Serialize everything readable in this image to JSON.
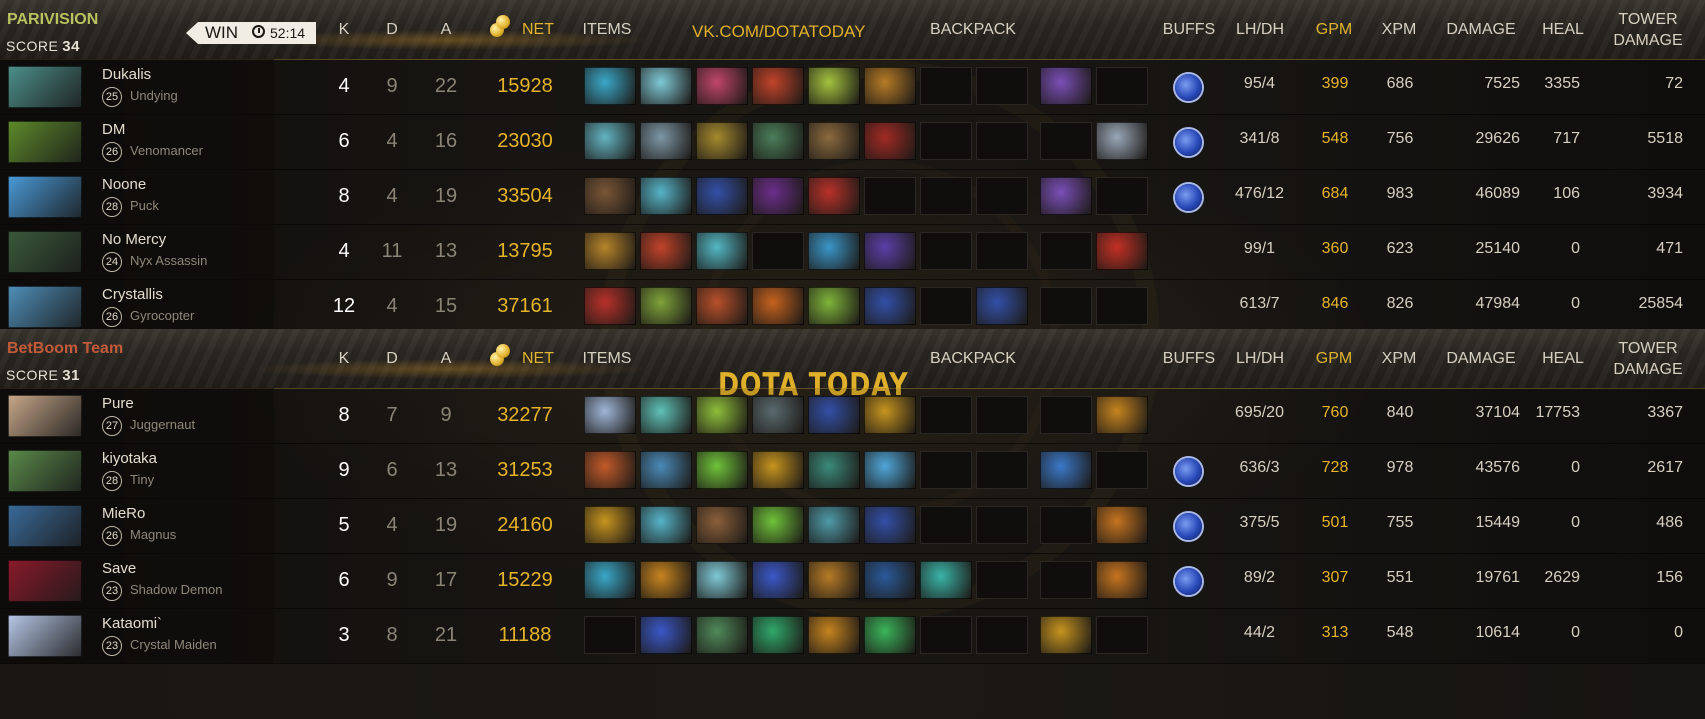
{
  "teams": [
    {
      "name": "PARIVISION",
      "name_color": "#b9c25e",
      "score_label": "SCORE",
      "score": "34",
      "badge": {
        "label": "WIN",
        "time": "52:14"
      },
      "header": {
        "k": "K",
        "d": "D",
        "a": "A",
        "net": "NET",
        "items": "ITEMS",
        "center": "VK.COM/DOTATODAY",
        "backpack": "BACKPACK",
        "buffs": "BUFFS",
        "lh": "LH/DH",
        "gpm": "GPM",
        "xpm": "XPM",
        "damage": "DAMAGE",
        "heal": "HEAL",
        "tower1": "TOWER",
        "tower2": "DAMAGE"
      },
      "players": [
        {
          "name": "Dukalis",
          "level": "25",
          "hero": "Undying",
          "k": "4",
          "d": "9",
          "a": "22",
          "net": "15928",
          "lh": "95/4",
          "gpm": "399",
          "xpm": "686",
          "damage": "7525",
          "heal": "3355",
          "tower": "72",
          "buff": true,
          "items": [
            "#3aa8c8",
            "#7fc9d6",
            "#c0456a",
            "#c2432a",
            "#a3c23e",
            "#b67b26"
          ],
          "backpack": [
            null,
            null,
            null
          ],
          "backpack2": [
            "#7a4fb8",
            null
          ]
        },
        {
          "name": "DM",
          "level": "26",
          "hero": "Venomancer",
          "k": "6",
          "d": "4",
          "a": "16",
          "net": "23030",
          "lh": "341/8",
          "gpm": "548",
          "xpm": "756",
          "damage": "29626",
          "heal": "717",
          "tower": "5518",
          "buff": true,
          "items": [
            "#63b4c2",
            "#7d97a6",
            "#a58a2e",
            "#4b7e5a",
            "#8b6a3e",
            "#a12a24"
          ],
          "backpack": [
            null,
            null,
            null
          ],
          "backpack2": [
            null,
            "#9aa7b8"
          ]
        },
        {
          "name": "Noone",
          "level": "28",
          "hero": "Puck",
          "k": "8",
          "d": "4",
          "a": "19",
          "net": "33504",
          "lh": "476/12",
          "gpm": "684",
          "xpm": "983",
          "damage": "46089",
          "heal": "106",
          "tower": "3934",
          "buff": true,
          "items": [
            "#7a5637",
            "#56b4c8",
            "#3350a8",
            "#6b2e8a",
            "#b8312a",
            null
          ],
          "backpack": [
            null,
            null,
            null
          ],
          "backpack2": [
            "#7a4fb8",
            null
          ]
        },
        {
          "name": "No Mercy",
          "level": "24",
          "hero": "Nyx Assassin",
          "k": "4",
          "d": "11",
          "a": "13",
          "net": "13795",
          "lh": "99/1",
          "gpm": "360",
          "xpm": "623",
          "damage": "25140",
          "heal": "0",
          "tower": "471",
          "buff": false,
          "items": [
            "#b6842a",
            "#c2432a",
            "#53b7c4",
            null,
            "#3a96c8",
            "#5b3fa8"
          ],
          "backpack": [
            null,
            null,
            null
          ],
          "backpack2": [
            null,
            "#c33024"
          ]
        },
        {
          "name": "Crystallis",
          "level": "26",
          "hero": "Gyrocopter",
          "k": "12",
          "d": "4",
          "a": "15",
          "net": "37161",
          "lh": "613/7",
          "gpm": "846",
          "xpm": "826",
          "damage": "47984",
          "heal": "0",
          "tower": "25854",
          "buff": false,
          "items": [
            "#b8312a",
            "#7fa33a",
            "#b8502a",
            "#c6621f",
            "#7fb43a",
            "#3350a8"
          ],
          "backpack": [
            null,
            "#3350a8",
            "#4fa6d8"
          ],
          "backpack2": [
            null,
            null
          ]
        }
      ]
    },
    {
      "name": "BetBoom Team",
      "name_color": "#c25a3a",
      "score_label": "SCORE",
      "score": "31",
      "header": {
        "k": "K",
        "d": "D",
        "a": "A",
        "net": "NET",
        "items": "ITEMS",
        "center": "DOTA TODAY",
        "backpack": "BACKPACK",
        "buffs": "BUFFS",
        "lh": "LH/DH",
        "gpm": "GPM",
        "xpm": "XPM",
        "damage": "DAMAGE",
        "heal": "HEAL",
        "tower1": "TOWER",
        "tower2": "DAMAGE"
      },
      "players": [
        {
          "name": "Pure",
          "level": "27",
          "hero": "Juggernaut",
          "k": "8",
          "d": "7",
          "a": "9",
          "net": "32277",
          "lh": "695/20",
          "gpm": "760",
          "xpm": "840",
          "damage": "37104",
          "heal": "17753",
          "tower": "3367",
          "buff": false,
          "items": [
            "#9fb6d8",
            "#5fc2b8",
            "#8fbf3a",
            "#5a6a6e",
            "#3350a8",
            "#c6941f"
          ],
          "backpack": [
            null,
            null,
            null
          ],
          "backpack2": [
            null,
            "#c6841f"
          ]
        },
        {
          "name": "kiyotaka",
          "level": "28",
          "hero": "Tiny",
          "k": "9",
          "d": "6",
          "a": "13",
          "net": "31253",
          "lh": "636/3",
          "gpm": "728",
          "xpm": "978",
          "damage": "43576",
          "heal": "0",
          "tower": "2617",
          "buff": true,
          "items": [
            "#c25a2a",
            "#4a8ab8",
            "#6fc23a",
            "#c6941f",
            "#3a8a7a",
            "#4fa6d8"
          ],
          "backpack": [
            null,
            null,
            null
          ],
          "backpack2": [
            "#3a78c8",
            null
          ]
        },
        {
          "name": "MieRo",
          "level": "26",
          "hero": "Magnus",
          "k": "5",
          "d": "4",
          "a": "19",
          "net": "24160",
          "lh": "375/5",
          "gpm": "501",
          "xpm": "755",
          "damage": "15449",
          "heal": "0",
          "tower": "486",
          "buff": true,
          "items": [
            "#c6941f",
            "#56b4c8",
            "#8a5f3a",
            "#6fc23a",
            "#4f9aa8",
            "#3350a8"
          ],
          "backpack": [
            null,
            null,
            null
          ],
          "backpack2": [
            null,
            "#c6741f"
          ]
        },
        {
          "name": "Save",
          "level": "23",
          "hero": "Shadow Demon",
          "k": "6",
          "d": "9",
          "a": "17",
          "net": "15229",
          "lh": "89/2",
          "gpm": "307",
          "xpm": "551",
          "damage": "19761",
          "heal": "2629",
          "tower": "156",
          "buff": true,
          "items": [
            "#3aa8c8",
            "#c6841f",
            "#7fc9d6",
            "#3a58c8",
            "#b67b26",
            "#2a5a9a"
          ],
          "backpack": [
            "#3ab4a8",
            null,
            null
          ],
          "backpack2": [
            null,
            "#c6741f"
          ]
        },
        {
          "name": "Kataomi`",
          "level": "23",
          "hero": "Crystal Maiden",
          "k": "3",
          "d": "8",
          "a": "21",
          "net": "11188",
          "lh": "44/2",
          "gpm": "313",
          "xpm": "548",
          "damage": "10614",
          "heal": "0",
          "tower": "0",
          "buff": false,
          "items": [
            null,
            "#3a58c8",
            "#4f8a5a",
            "#2fa86a",
            "#c6841f",
            "#3ab45a"
          ],
          "backpack": [
            null,
            null,
            null
          ],
          "backpack2": [
            "#c6941f",
            null
          ]
        }
      ]
    }
  ],
  "portrait_colors": [
    "#4d8f8a",
    "#5d8a2a",
    "#4a9ad8",
    "#3a5a3a",
    "#4f8fb8",
    "#c8a88a",
    "#5a8a4a",
    "#3a6a9a",
    "#8a1a2a",
    "#b8c8e8"
  ],
  "icons": {
    "win": "play-pointer-icon",
    "clock": "clock-icon",
    "gold": "gold-coins-icon",
    "buff": "aghanim-shard-buff-icon"
  }
}
